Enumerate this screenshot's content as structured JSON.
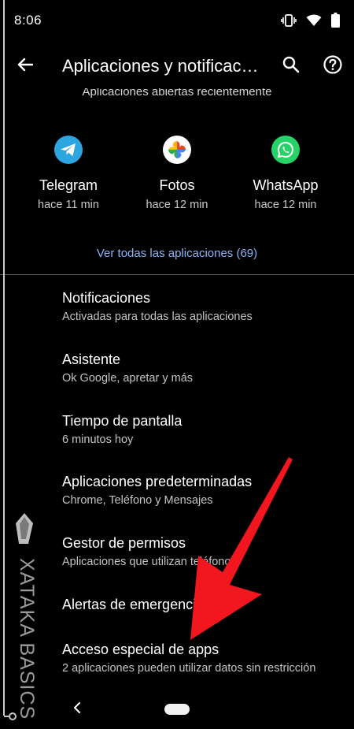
{
  "status_bar": {
    "time": "8:06",
    "icons": [
      "vibrate-icon",
      "wifi-icon",
      "battery-icon"
    ]
  },
  "app_bar": {
    "title": "Aplicaciones y notificac…",
    "icons": [
      "back-arrow-icon",
      "search-icon",
      "help-icon"
    ]
  },
  "recent": {
    "header": "Aplicaciones abiertas recientemente",
    "apps": [
      {
        "name": "Telegram",
        "time": "hace 11 min",
        "icon": "telegram-icon",
        "color": "#2ca5e0"
      },
      {
        "name": "Fotos",
        "time": "hace 12 min",
        "icon": "google-photos-icon",
        "color": "#ffffff"
      },
      {
        "name": "WhatsApp",
        "time": "hace 12 min",
        "icon": "whatsapp-icon",
        "color": "#25d366"
      }
    ],
    "see_all": "Ver todas las aplicaciones (69)"
  },
  "settings": [
    {
      "title": "Notificaciones",
      "subtitle": "Activadas para todas las aplicaciones"
    },
    {
      "title": "Asistente",
      "subtitle": "Ok Google, apretar y más"
    },
    {
      "title": "Tiempo de pantalla",
      "subtitle": "6 minutos hoy"
    },
    {
      "title": "Aplicaciones predeterminadas",
      "subtitle": "Chrome, Teléfono y Mensajes"
    },
    {
      "title": "Gestor de permisos",
      "subtitle": "Aplicaciones que utilizan teléfono"
    },
    {
      "title": "Alertas de emergencia",
      "subtitle": ""
    },
    {
      "title": "Acceso especial de apps",
      "subtitle": "2 aplicaciones pueden utilizar datos sin restricción"
    }
  ],
  "watermark": {
    "text": "XATAKA BASICS"
  },
  "annotation": {
    "arrow_color": "#f2161e"
  },
  "nav_bar": {
    "icons": [
      "nav-back-icon",
      "home-pill-icon"
    ]
  }
}
